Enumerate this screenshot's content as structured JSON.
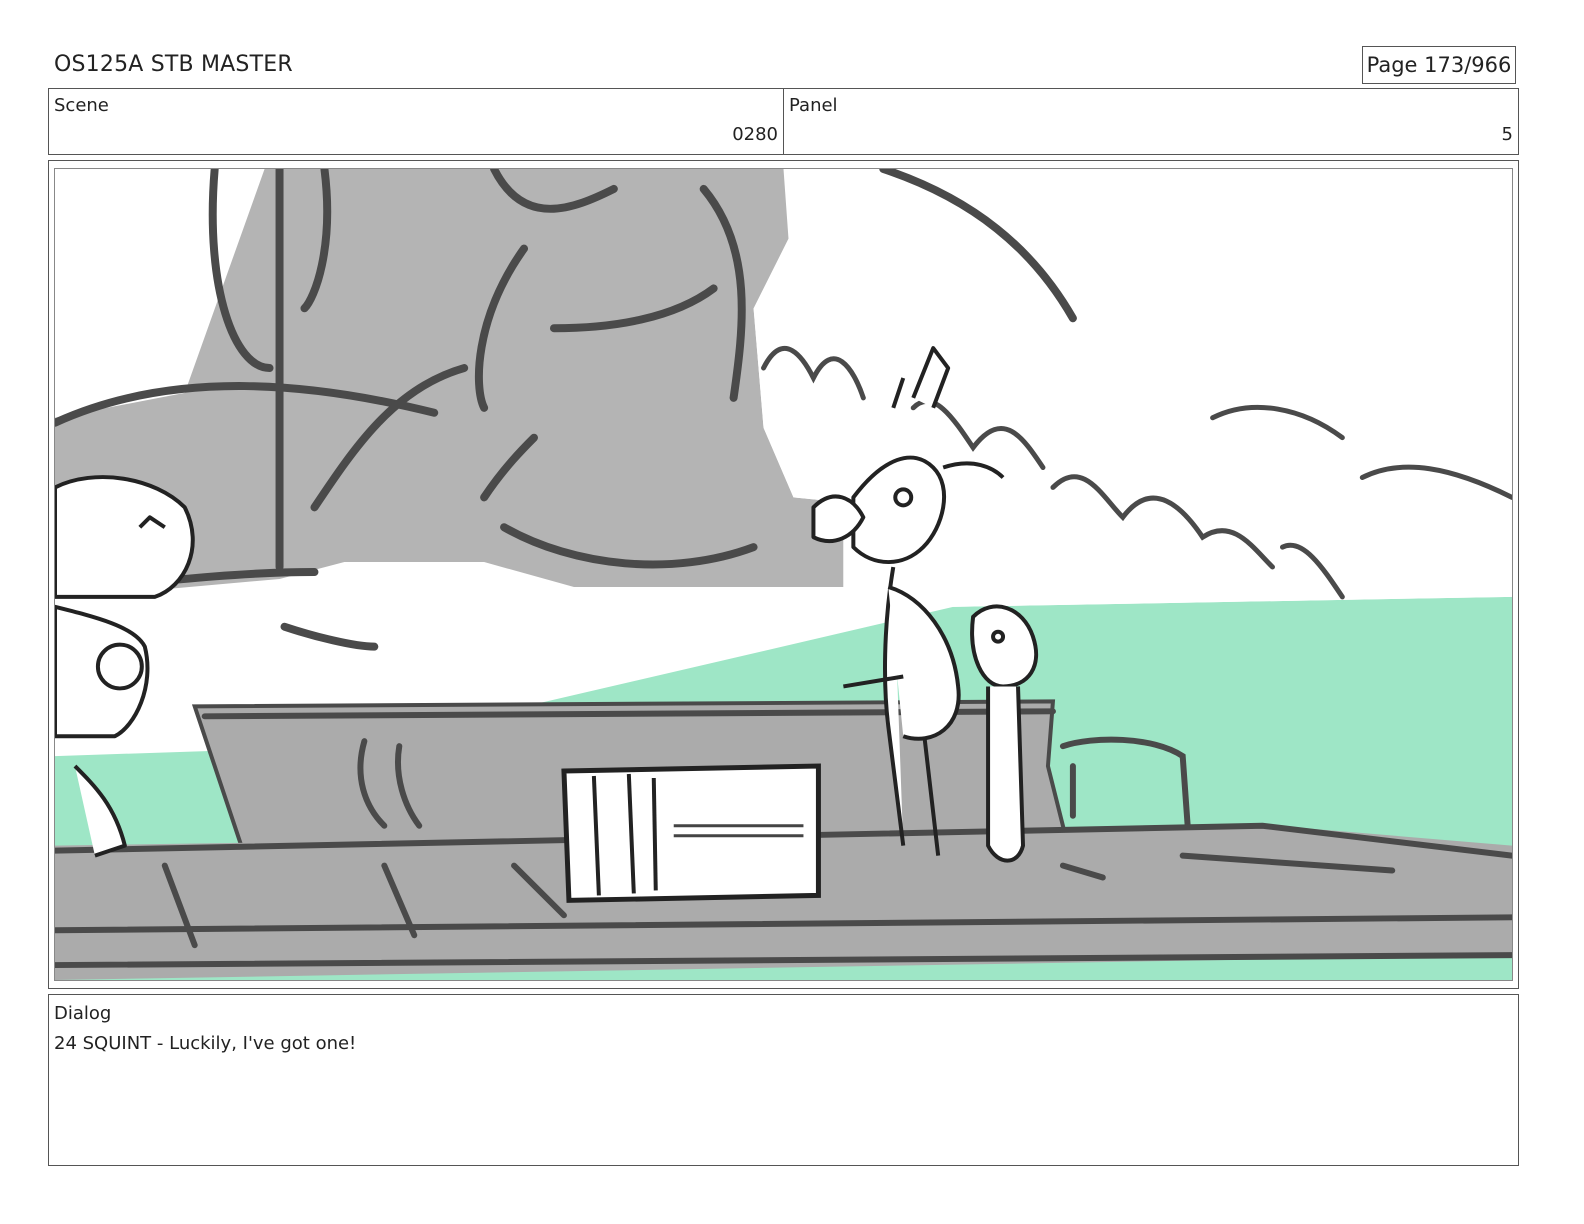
{
  "header": {
    "title": "OS125A STB MASTER",
    "page": "Page 173/966"
  },
  "info": {
    "scene_label": "Scene",
    "scene_value": "0280",
    "panel_label": "Panel",
    "panel_value": "5"
  },
  "dialog": {
    "label": "Dialog",
    "text": "24 SQUINT - Luckily, I've got one!"
  },
  "colors": {
    "sea": "#9ee6c6",
    "sail": "#b4b4b4",
    "deck": "#ababab",
    "ink": "#4a4a4a"
  }
}
